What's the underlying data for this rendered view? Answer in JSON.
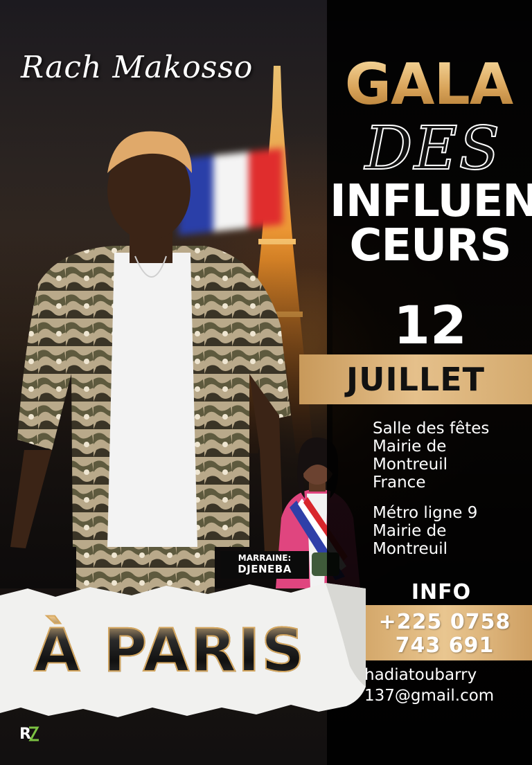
{
  "brand": {
    "name": "Rach Makosso"
  },
  "title": {
    "line1": "GALA",
    "line2": "DES",
    "line3": "INFLUEN",
    "line4": "CEURS"
  },
  "date": {
    "day": "12",
    "month": "JUILLET"
  },
  "venue": {
    "lines": [
      "Salle des fêtes",
      "Mairie de",
      "Montreuil",
      "France"
    ],
    "metro_lines": [
      "Métro ligne  9",
      "Mairie de",
      "Montreuil"
    ]
  },
  "marraine": {
    "label": "MARRAINE:",
    "name": "DJENEBA"
  },
  "city": "À PARIS",
  "info": {
    "heading": "INFO",
    "phone_lines": [
      "+225  0758",
      "743  691"
    ],
    "email_lines": [
      "hadiatoubarry",
      "137@gmail.com"
    ]
  },
  "colors": {
    "gold": "#d9a45a",
    "gold_light": "#f6d89c",
    "flag_blue": "#2a3fa8",
    "flag_red": "#e02d2d"
  }
}
